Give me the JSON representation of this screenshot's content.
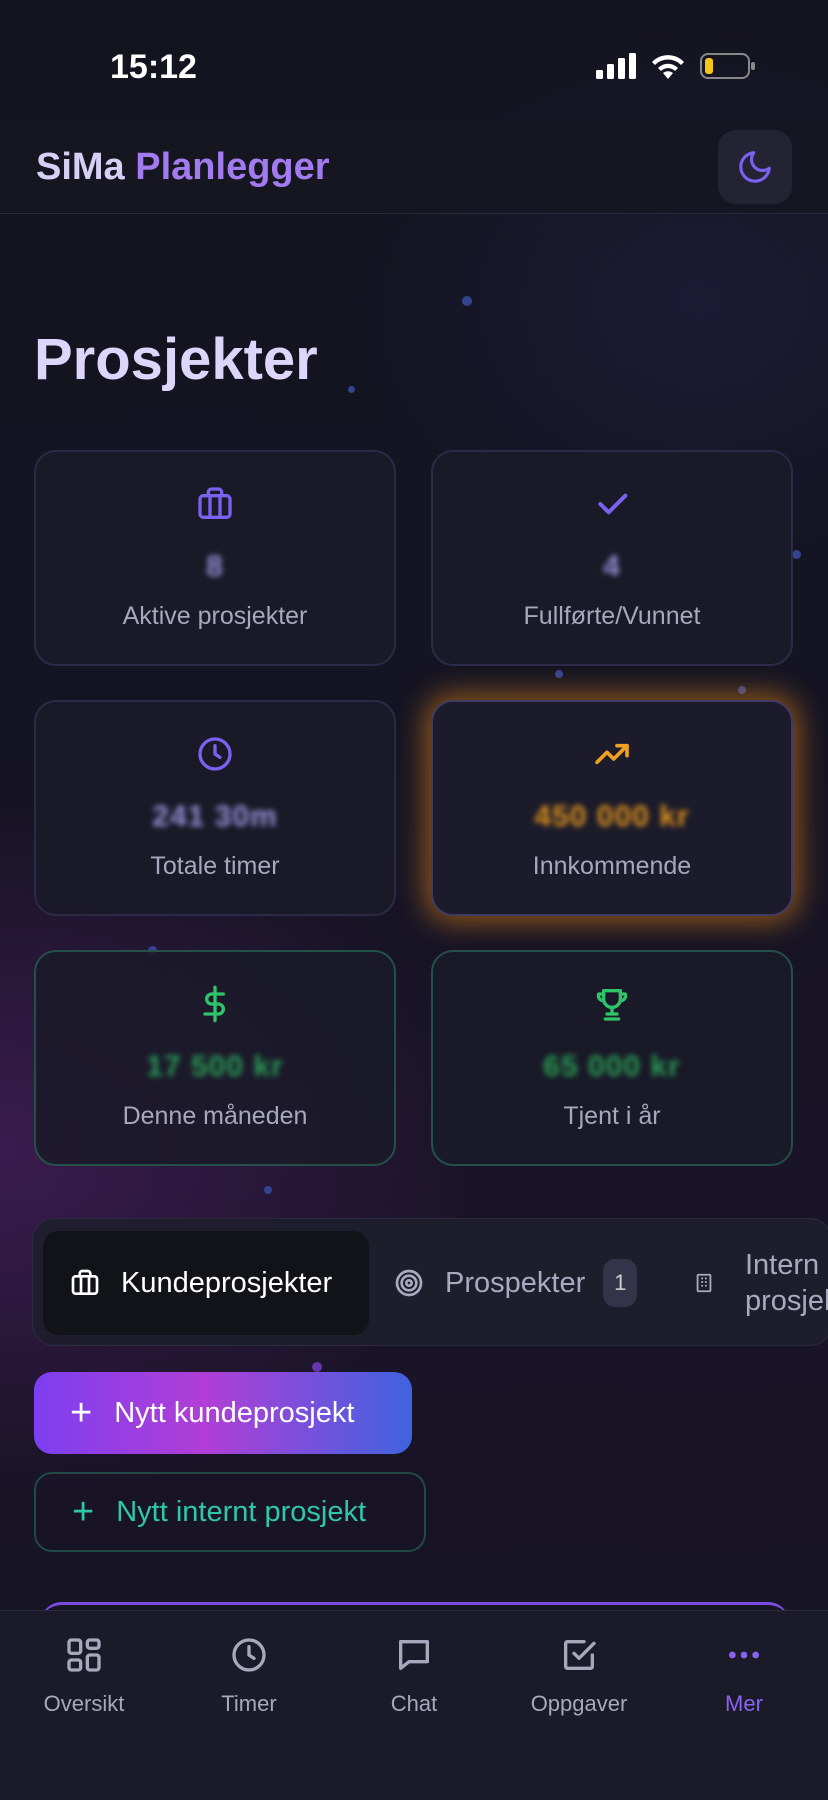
{
  "status_bar": {
    "time": "15:12"
  },
  "header": {
    "brand_part1": "SiMa",
    "brand_part2": "Planlegger",
    "theme_icon": "moon-icon"
  },
  "page": {
    "title": "Prosjekter"
  },
  "stats": [
    {
      "icon": "briefcase-icon",
      "value": "8",
      "label": "Aktive prosjekter",
      "color": "#7b61f0"
    },
    {
      "icon": "check-icon",
      "value": "4",
      "label": "Fullførte/Vunnet",
      "color": "#7b61f0"
    },
    {
      "icon": "clock-icon",
      "value": "241 30m",
      "label": "Totale timer",
      "color": "#7b61f0"
    },
    {
      "icon": "trending-up-icon",
      "value": "450 000 kr",
      "label": "Innkommende",
      "color": "#f0a020"
    },
    {
      "icon": "dollar-icon",
      "value": "17 500 kr",
      "label": "Denne måneden",
      "color": "#2fc46a"
    },
    {
      "icon": "trophy-icon",
      "value": "65 000 kr",
      "label": "Tjent i år",
      "color": "#2fc46a"
    }
  ],
  "tabs": {
    "active": {
      "label": "Kundeprosjekter",
      "icon": "briefcase-icon"
    },
    "prospects": {
      "label": "Prospekter",
      "icon": "target-icon",
      "badge": "1"
    },
    "internal": {
      "label_line1": "Intern",
      "label_line2": "prosjek",
      "icon": "building-icon"
    }
  },
  "actions": {
    "new_customer": "Nytt kundeprosjekt",
    "new_internal": "Nytt internt prosjekt"
  },
  "nav": [
    {
      "label": "Oversikt",
      "icon": "grid-icon"
    },
    {
      "label": "Timer",
      "icon": "clock-icon"
    },
    {
      "label": "Chat",
      "icon": "chat-icon"
    },
    {
      "label": "Oppgaver",
      "icon": "checkbox-icon"
    },
    {
      "label": "Mer",
      "icon": "more-icon"
    }
  ]
}
